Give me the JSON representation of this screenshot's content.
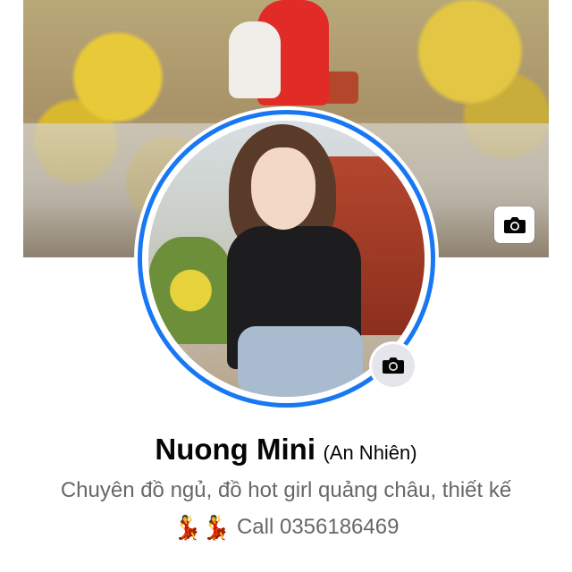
{
  "profile": {
    "name": "Nuong Mini",
    "alternate_name": "(An Nhiên)",
    "bio": "Chuyên đồ ngủ, đồ hot girl quảng châu, thiết kế",
    "contact_emojis": "💃💃",
    "contact_text": "Call 0356186469"
  },
  "icons": {
    "cover_camera": "camera-icon",
    "avatar_camera": "camera-icon"
  },
  "colors": {
    "accent": "#1877f2",
    "name_text": "#050505",
    "secondary_text": "#65676b",
    "camera_button_bg": "#e4e6eb"
  }
}
